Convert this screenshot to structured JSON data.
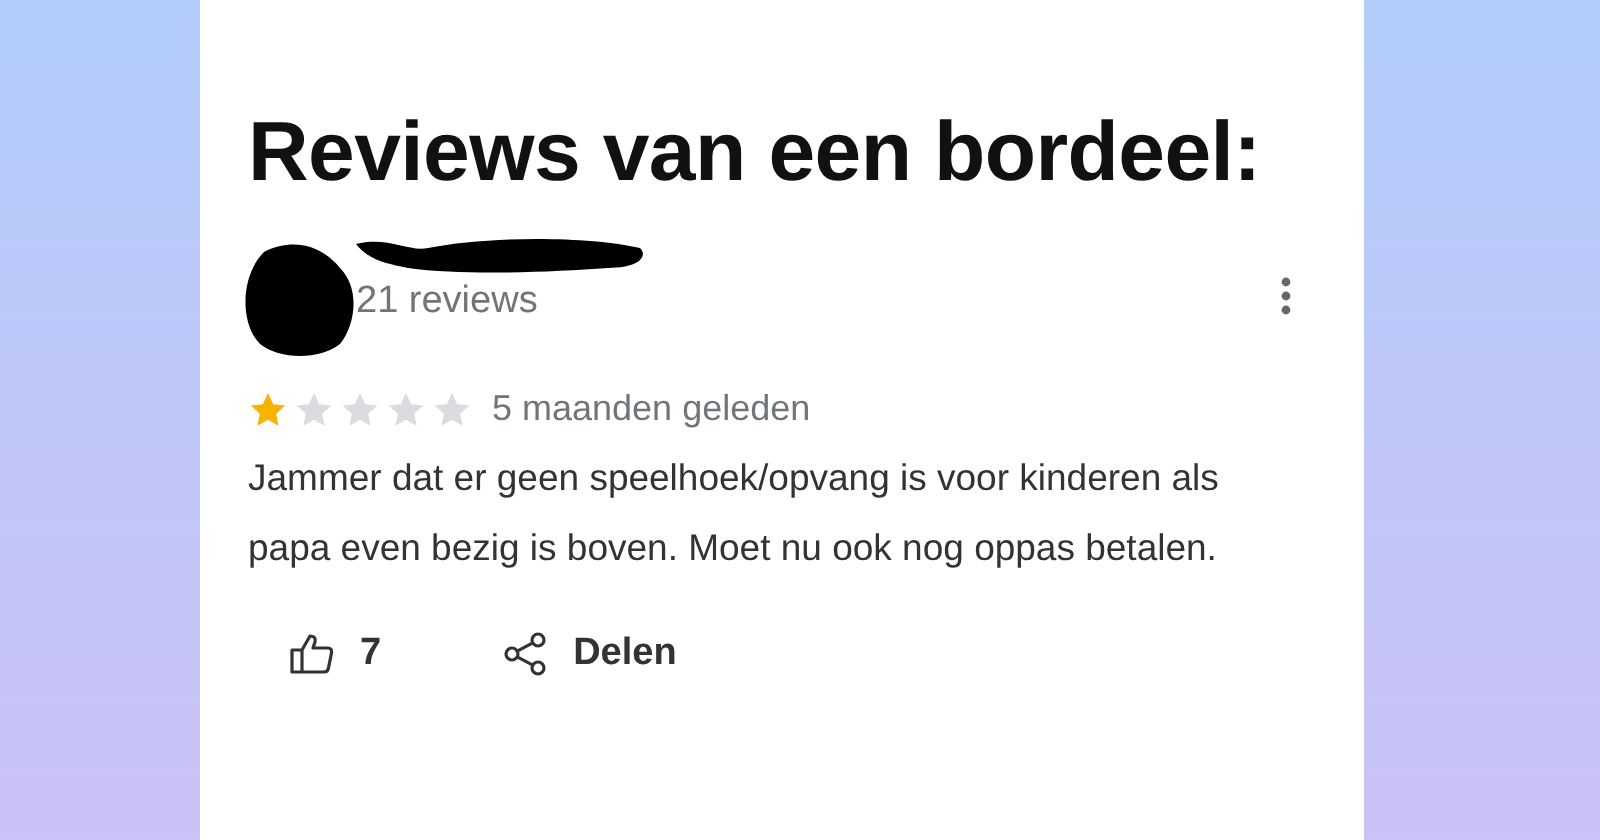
{
  "title": "Reviews van een bordeel:",
  "review": {
    "reviewer_meta": "21 reviews",
    "stars": 1,
    "time": "5 maanden geleden",
    "text": "Jammer dat er geen speelhoek/opvang is voor kinderen als papa even bezig is boven. Moet nu ook nog oppas betalen.",
    "likes": "7",
    "share_label": "Delen"
  }
}
